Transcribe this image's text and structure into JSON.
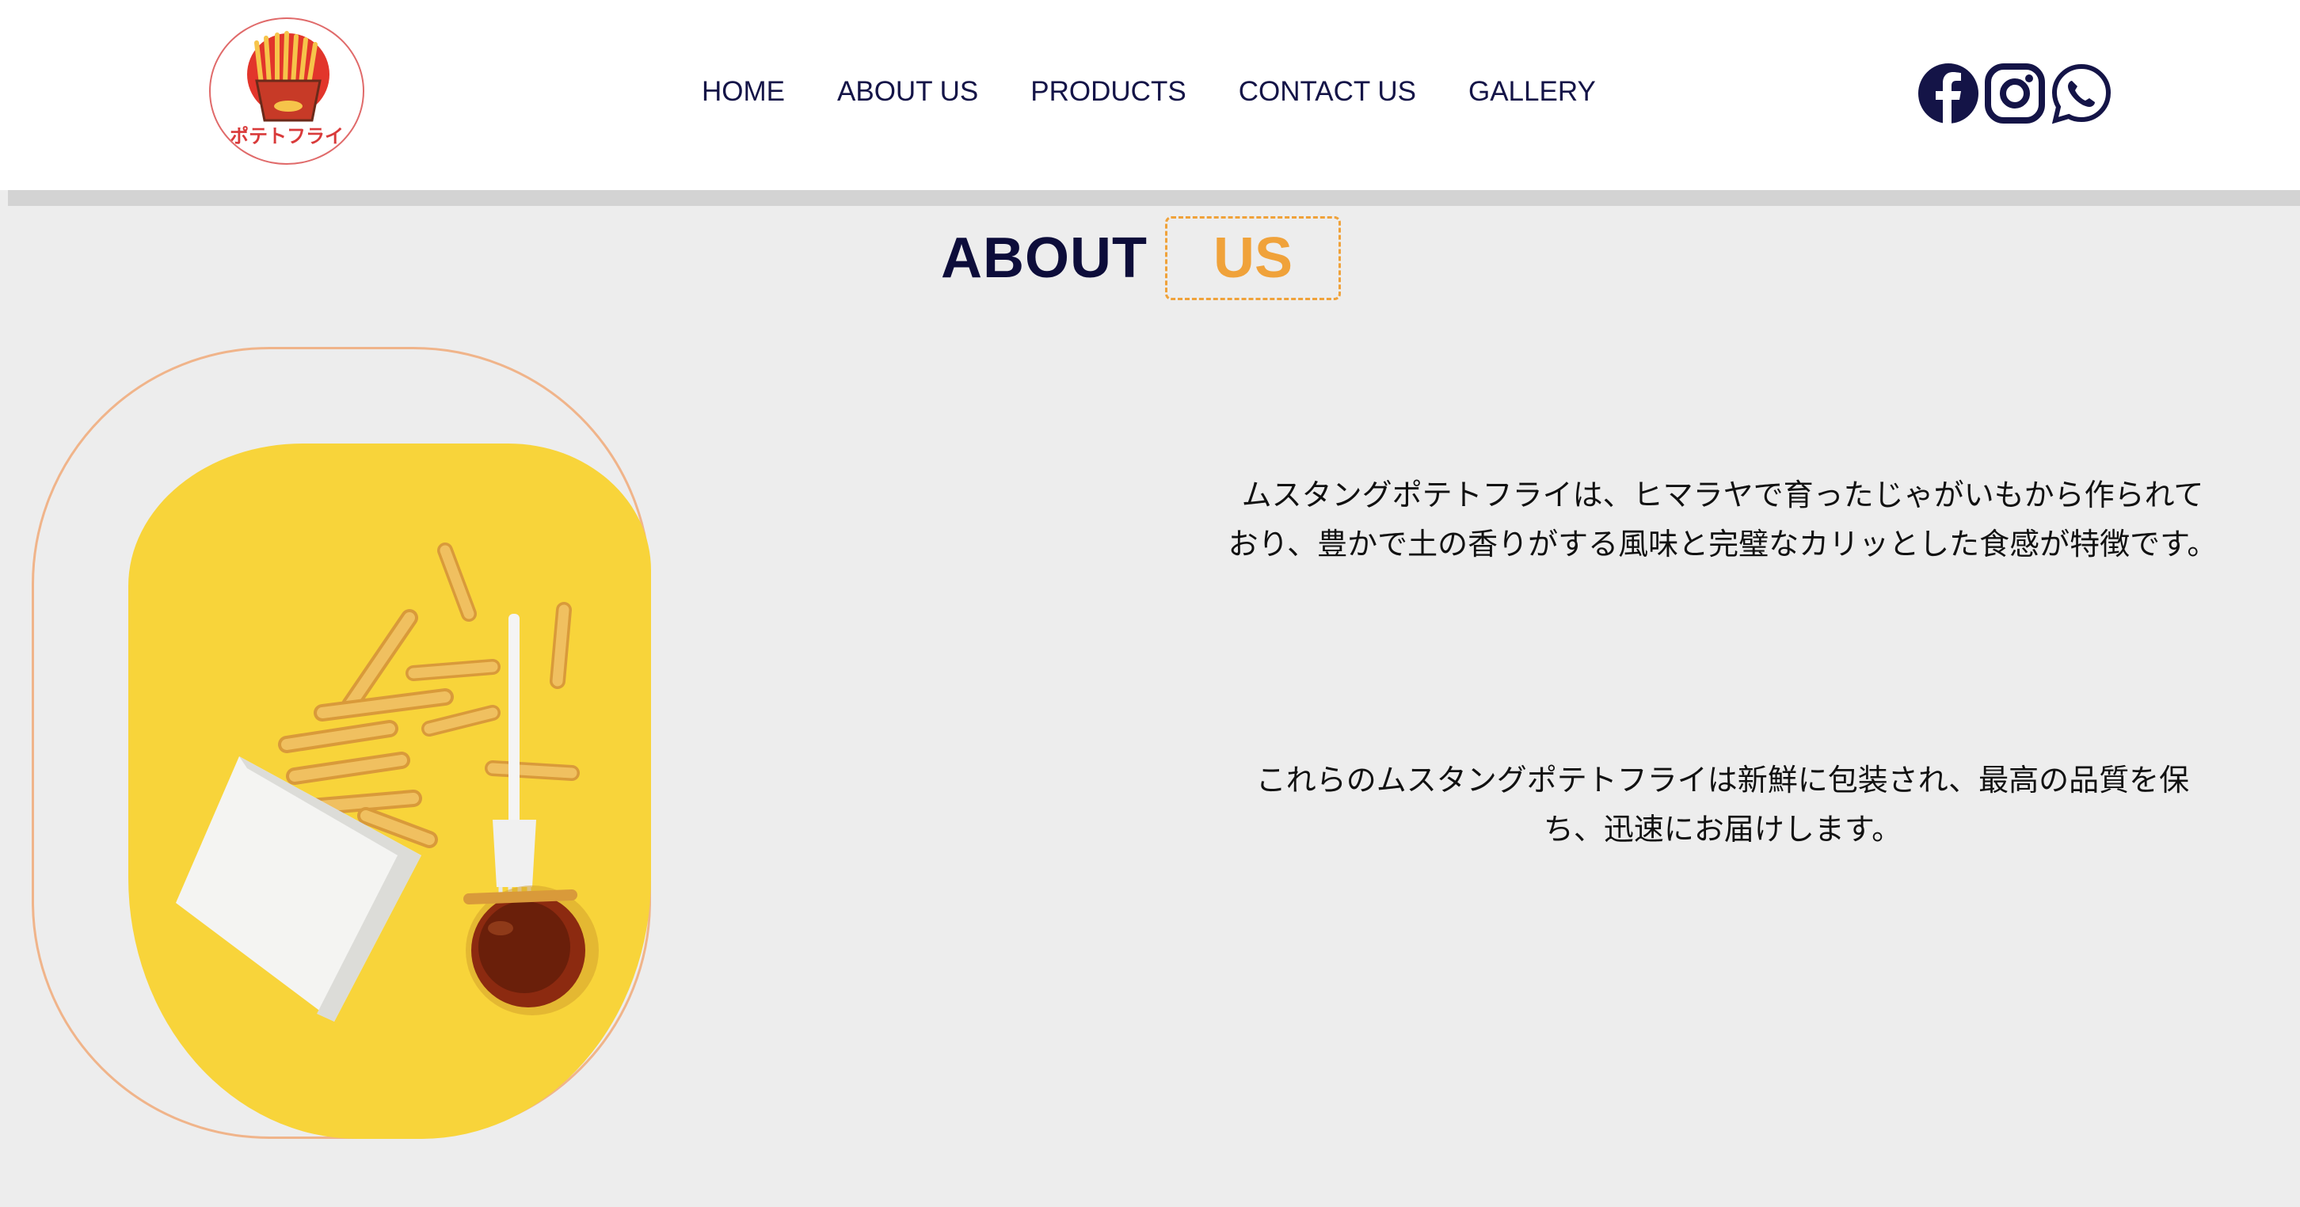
{
  "brand": {
    "logo_text": "ポテトフライ"
  },
  "nav": {
    "items": [
      {
        "label": "HOME"
      },
      {
        "label": "ABOUT US"
      },
      {
        "label": "PRODUCTS"
      },
      {
        "label": "CONTACT US"
      },
      {
        "label": "GALLERY"
      }
    ]
  },
  "social": {
    "icons": [
      "facebook-icon",
      "instagram-icon",
      "whatsapp-icon"
    ]
  },
  "section": {
    "title_main": "ABOUT",
    "title_highlight": "US"
  },
  "about": {
    "paragraph_1": "ムスタングポテトフライは、ヒマラヤで育ったじゃがいもから作られており、豊かで土の香りがする風味と完璧なカリッとした食感が特徴です。",
    "paragraph_2": "これらのムスタングポテトフライは新鮮に包装され、最高の品質を保ち、迅速にお届けします。"
  },
  "colors": {
    "navy": "#0d0d3a",
    "accent": "#f0a23a",
    "frame": "#f0b48a",
    "card_yellow": "#f8d43a",
    "background": "#ededed"
  }
}
